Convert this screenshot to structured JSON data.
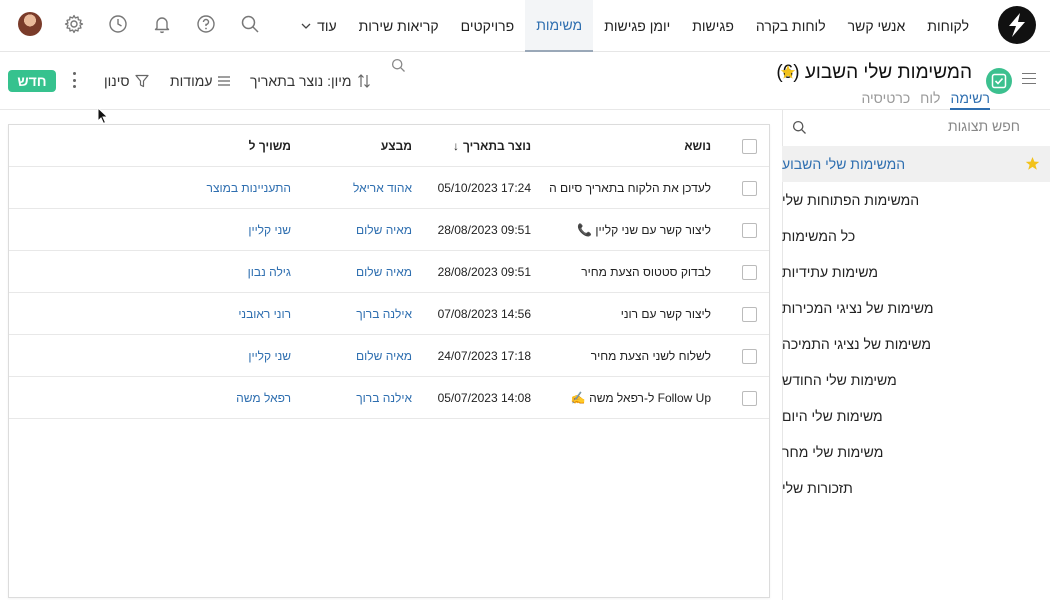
{
  "nav": {
    "items": [
      {
        "label": "לקוחות"
      },
      {
        "label": "אנשי קשר"
      },
      {
        "label": "לוחות בקרה"
      },
      {
        "label": "פגישות"
      },
      {
        "label": "יומן פגישות"
      },
      {
        "label": "משימות",
        "active": true
      },
      {
        "label": "פרויקטים"
      },
      {
        "label": "קריאות שירות"
      },
      {
        "label": "עוד"
      }
    ]
  },
  "header": {
    "title": "המשימות שלי השבוע (6)",
    "view_tabs": [
      "רשימה",
      "לוח",
      "כרטיסיה"
    ],
    "sort_label": "מיון: נוצר בתאריך",
    "columns_label": "עמודות",
    "filter_label": "סינון",
    "new_label": "חדש"
  },
  "sidebar": {
    "search_placeholder": "חפש תצוגות",
    "items": [
      {
        "label": "המשימות שלי השבוע",
        "active": true
      },
      {
        "label": "המשימות הפתוחות שלי"
      },
      {
        "label": "כל המשימות"
      },
      {
        "label": "משימות עתידיות"
      },
      {
        "label": "משימות של נציגי המכירות"
      },
      {
        "label": "משימות של נציגי התמיכה"
      },
      {
        "label": "משימות שלי החודש"
      },
      {
        "label": "משימות שלי היום"
      },
      {
        "label": "משימות שלי מחר"
      },
      {
        "label": "תזכורות שלי"
      }
    ]
  },
  "table": {
    "headers": {
      "subject": "נושא",
      "created": "נוצר בתאריך",
      "sort_arrow": "↓",
      "owner": "מבצע",
      "related": "משויך ל"
    },
    "rows": [
      {
        "subject": "לעדכן את הלקוח בתאריך סיום ה...",
        "created": "05/10/2023 17:24",
        "owner": "אהוד אריאל",
        "related": "התעניינות במוצר"
      },
      {
        "subject": "ליצור קשר עם שני קליין 📞",
        "created": "28/08/2023 09:51",
        "owner": "מאיה שלום",
        "related": "שני קליין"
      },
      {
        "subject": "לבדוק סטטוס הצעת מחיר",
        "created": "28/08/2023 09:51",
        "owner": "מאיה שלום",
        "related": "גילה נבון"
      },
      {
        "subject": "ליצור קשר עם רוני",
        "created": "07/08/2023 14:56",
        "owner": "אילנה ברוך",
        "related": "רוני ראובני"
      },
      {
        "subject": "לשלוח לשני הצעת מחיר",
        "created": "24/07/2023 17:18",
        "owner": "מאיה שלום",
        "related": "שני קליין"
      },
      {
        "subject": "Follow Up ל-רפאל משה ✍️",
        "created": "05/07/2023 14:08",
        "owner": "אילנה ברוך",
        "related": "רפאל משה"
      }
    ]
  },
  "colors": {
    "accent": "#2f6fb0",
    "new_button": "#36c28e",
    "star": "#f2c21b"
  }
}
